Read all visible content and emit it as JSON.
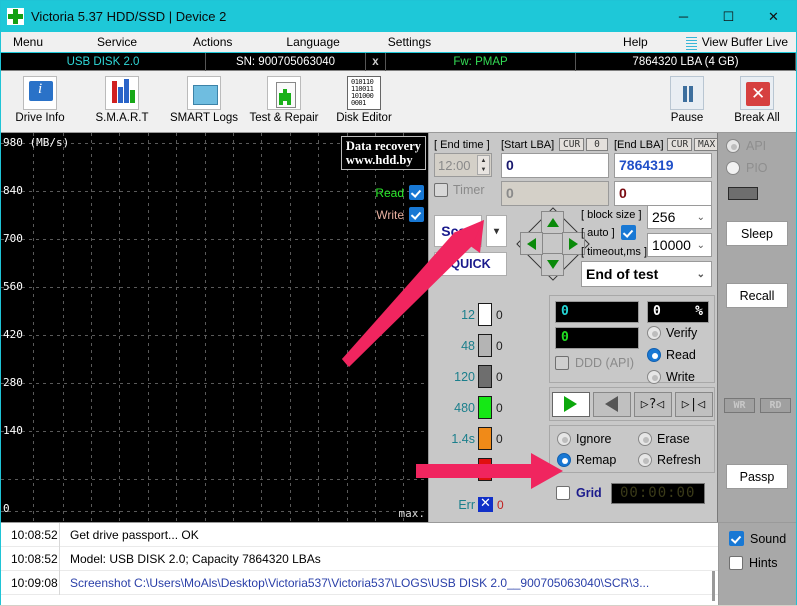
{
  "window": {
    "title": "Victoria 5.37 HDD/SSD | Device 2",
    "minimize": "─",
    "maximize": "☐",
    "close": "✕"
  },
  "menubar": {
    "items": [
      "Menu",
      "Service",
      "Actions",
      "Language",
      "Settings"
    ],
    "help": "Help",
    "view_buffer": "View Buffer Live"
  },
  "drivebar": {
    "model": "USB DISK 2.0",
    "serial": "SN: 900705063040",
    "x": "x",
    "firmware": "Fw: PMAP",
    "capacity": "7864320 LBA (4 GB)"
  },
  "toolbar": {
    "buttons": [
      {
        "label": "Drive Info",
        "icon": "info-icon"
      },
      {
        "label": "S.M.A.R.T",
        "icon": "smart-icon"
      },
      {
        "label": "SMART Logs",
        "icon": "smart-logs-icon"
      },
      {
        "label": "Test & Repair",
        "icon": "test-repair-icon"
      },
      {
        "label": "Disk Editor",
        "icon": "disk-editor-icon"
      }
    ],
    "pause": "Pause",
    "break_all": "Break All"
  },
  "graph": {
    "y_unit": "980 (MB/s)",
    "y_ticks": [
      "980 (MB/s)",
      "840",
      "700",
      "560",
      "420",
      "280",
      "140",
      "0"
    ],
    "x_max_label": "max.",
    "watermark_line1": "Data recovery",
    "watermark_line2": "www.hdd.by",
    "read_label": "Read",
    "write_label": "Write"
  },
  "controls": {
    "end_time_label": "[ End time ]",
    "end_time_value": "12:00",
    "timer_label": "Timer",
    "start_lba_label": "[Start LBA]",
    "start_lba_cur": "CUR",
    "start_lba_zero_btn": "0",
    "start_lba_value": "0",
    "start_lba_second": "0",
    "end_lba_label": "[End LBA]",
    "end_lba_cur": "CUR",
    "end_lba_max": "MAX",
    "end_lba_value": "7864319",
    "end_lba_second": "0",
    "scan_button": "Scan",
    "scan_dropdown": "▾",
    "quick_button": "QUICK",
    "block_size_label": "[ block size ]",
    "block_size_value": "256",
    "auto_label": "[ auto ]",
    "timeout_label": "[ timeout,ms ]",
    "timeout_value": "10000",
    "end_of_test_value": "End of test"
  },
  "legend": {
    "rows": [
      {
        "time": "12",
        "color": "#ffffff",
        "count": "0"
      },
      {
        "time": "48",
        "color": "#b4b4b4",
        "count": "0"
      },
      {
        "time": "120",
        "color": "#6e6e6e",
        "count": "0"
      },
      {
        "time": "480",
        "color": "#15e815",
        "count": "0"
      },
      {
        "time": "1.4s",
        "color": "#f08a18",
        "count": "0"
      },
      {
        "time": ">",
        "color": "#e01010",
        "count": "0"
      }
    ],
    "err_label": "Err",
    "err_count": "0"
  },
  "status": {
    "counter_cyan": "0",
    "counter_green": "0",
    "percent_value": "0",
    "percent_sign": "%",
    "ddd_api_label": "DDD (API)",
    "modes": [
      "Verify",
      "Read",
      "Write"
    ],
    "selected_mode": "Read",
    "transport": [
      "play-icon",
      "rewind-icon",
      "seek-query-icon",
      "seek-end-icon"
    ],
    "defect_actions": [
      "Ignore",
      "Erase",
      "Remap",
      "Refresh"
    ],
    "selected_defect_action": "Remap",
    "grid_label": "Grid",
    "timer_display": "00:00:00"
  },
  "sidebar": {
    "api_label": "API",
    "pio_label": "PIO",
    "sleep_button": "Sleep",
    "recall_button": "Recall",
    "wr_button": "WR",
    "rd_button": "RD",
    "passp_button": "Passp"
  },
  "log": {
    "entries": [
      {
        "time": "10:08:52",
        "message": "Get drive passport... OK",
        "link": false
      },
      {
        "time": "10:08:52",
        "message": "Model: USB DISK 2.0; Capacity 7864320 LBAs",
        "link": false
      },
      {
        "time": "10:09:08",
        "message": "Screenshot C:\\Users\\MoAls\\Desktop\\Victoria537\\Victoria537\\LOGS\\USB DISK 2.0__900705063040\\SCR\\3...",
        "link": true
      }
    ],
    "sound_label": "Sound",
    "hints_label": "Hints"
  },
  "annotations": {
    "arrow_color": "#f0255f",
    "arrow1_target": "Scan",
    "arrow2_target": "Remap"
  }
}
